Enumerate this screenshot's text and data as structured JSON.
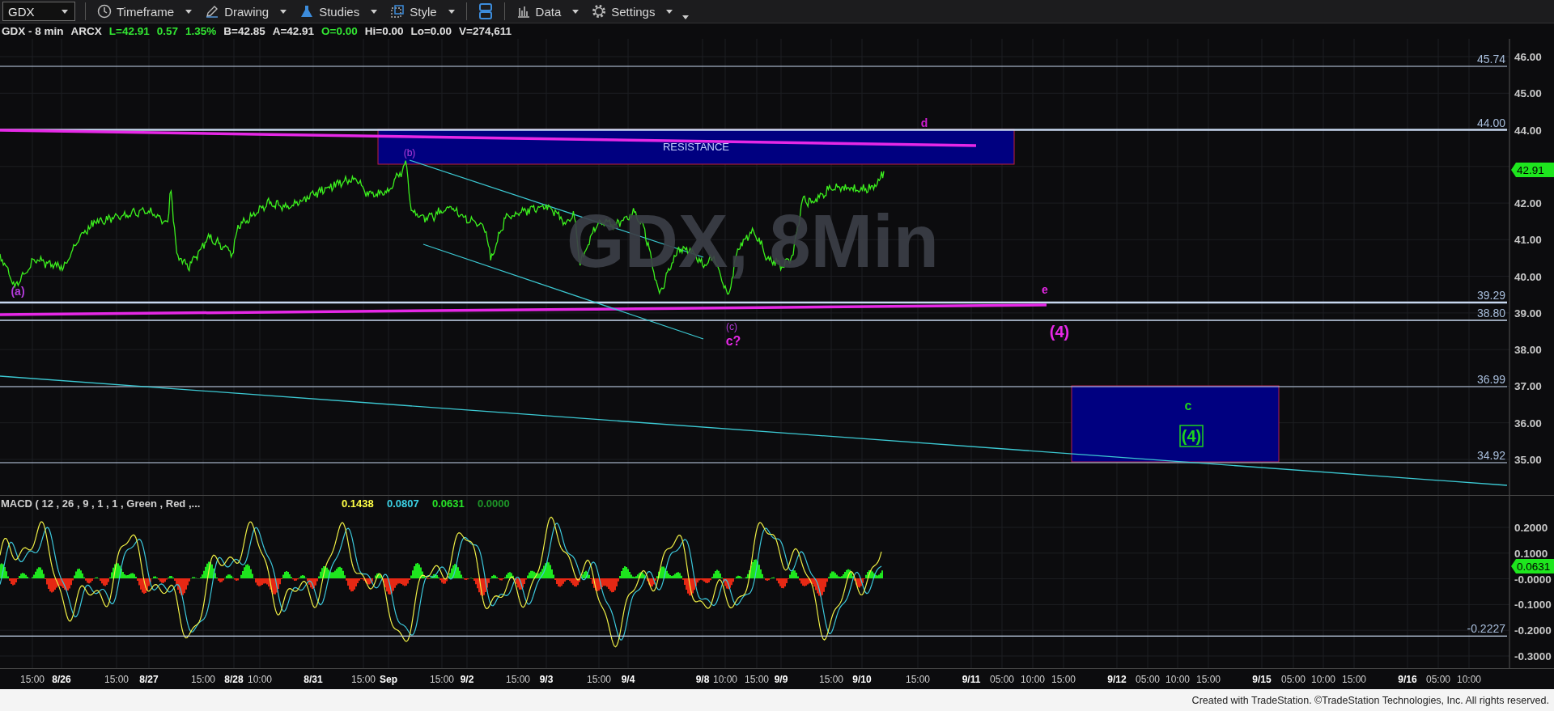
{
  "toolbar": {
    "symbol": "GDX",
    "buttons": [
      {
        "kind": "clock",
        "label": "Timeframe"
      },
      {
        "kind": "pen",
        "label": "Drawing"
      },
      {
        "kind": "flask",
        "label": "Studies"
      },
      {
        "kind": "style",
        "label": "Style"
      },
      {
        "kind": "layout"
      },
      {
        "kind": "bars",
        "label": "Data"
      },
      {
        "kind": "gear",
        "label": "Settings"
      },
      {
        "kind": "more"
      }
    ]
  },
  "quote": [
    {
      "text": "GDX - 8 min",
      "color": "#e0e0e0"
    },
    {
      "text": "ARCX",
      "color": "#e0e0e0"
    },
    {
      "text": "L=42.91",
      "color": "#33e633"
    },
    {
      "text": "0.57",
      "color": "#33e633"
    },
    {
      "text": "1.35%",
      "color": "#33e633"
    },
    {
      "text": "B=42.85",
      "color": "#e0e0e0"
    },
    {
      "text": "A=42.91",
      "color": "#e0e0e0"
    },
    {
      "text": "O=0.00",
      "color": "#33e633"
    },
    {
      "text": "Hi=0.00",
      "color": "#e0e0e0"
    },
    {
      "text": "Lo=0.00",
      "color": "#e0e0e0"
    },
    {
      "text": "V=274,611",
      "color": "#e0e0e0"
    }
  ],
  "price_chart": {
    "watermark": [
      "GDX, 8Min"
    ],
    "axis_labels": [
      "46.00",
      "45.00",
      "44.00",
      "42.00",
      "41.00",
      "40.00",
      "39.00",
      "38.00",
      "37.00",
      "36.00",
      "35.00"
    ],
    "last_price": "42.91",
    "levels": [
      {
        "label": "45.74"
      },
      {
        "label": "44.00"
      },
      {
        "label": "39.29"
      },
      {
        "label": "38.80"
      },
      {
        "label": "36.99"
      },
      {
        "label": "34.92"
      }
    ],
    "zones": [
      {
        "kind": "resistance",
        "label": "RESISTANCE"
      },
      {
        "kind": "target"
      }
    ],
    "wave_labels": [
      {
        "text": "d",
        "kind": "medium",
        "color": "#d21ed2"
      },
      {
        "text": "(b)",
        "kind": "small",
        "color": "#b43cdc"
      },
      {
        "text": "e",
        "kind": "medium",
        "color": "#e628e6"
      },
      {
        "text": "(a)",
        "kind": "medium",
        "color": "#b43cdc"
      },
      {
        "text": "(c)",
        "kind": "small",
        "color": "#b43cdc"
      },
      {
        "text": "c?",
        "kind": "bold",
        "color": "#e628e6"
      },
      {
        "text": "(4)",
        "kind": "large",
        "color": "#e628e6"
      },
      {
        "text": "c",
        "kind": "bold",
        "color": "#1ed21e"
      },
      {
        "text": "(4)",
        "kind": "boxed",
        "color": "#1ed21e"
      }
    ]
  },
  "macd": {
    "title": "MACD ( 12 , 26 , 9 , 1 , 1 , Green , Red ,...",
    "values": [
      {
        "text": "0.1438",
        "color": "#ffff46"
      },
      {
        "text": "0.0807",
        "color": "#3cd2e6"
      },
      {
        "text": "0.0631",
        "color": "#28e628"
      },
      {
        "text": "0.0000",
        "color": "#1e9628"
      }
    ],
    "axis_labels": [
      "0.2000",
      "0.1000",
      "-0.0000",
      "-0.1000",
      "-0.2000",
      "-0.3000"
    ],
    "last_value": "0.0631",
    "level_label": "-0.2227"
  },
  "time_axis": [
    {
      "text": "15:00",
      "kind": "time"
    },
    {
      "text": "8/26",
      "kind": "date"
    },
    {
      "text": "15:00",
      "kind": "time"
    },
    {
      "text": "8/27",
      "kind": "date"
    },
    {
      "text": "15:00",
      "kind": "time"
    },
    {
      "text": "8/28",
      "kind": "date"
    },
    {
      "text": "10:00",
      "kind": "time"
    },
    {
      "text": "8/31",
      "kind": "date"
    },
    {
      "text": "15:00",
      "kind": "time"
    },
    {
      "text": "Sep",
      "kind": "date"
    },
    {
      "text": "15:00",
      "kind": "time"
    },
    {
      "text": "9/2",
      "kind": "date"
    },
    {
      "text": "15:00",
      "kind": "time"
    },
    {
      "text": "9/3",
      "kind": "date"
    },
    {
      "text": "15:00",
      "kind": "time"
    },
    {
      "text": "9/4",
      "kind": "date"
    },
    {
      "text": "9/8",
      "kind": "date"
    },
    {
      "text": "10:00",
      "kind": "time"
    },
    {
      "text": "15:00",
      "kind": "time"
    },
    {
      "text": "9/9",
      "kind": "date"
    },
    {
      "text": "15:00",
      "kind": "time"
    },
    {
      "text": "9/10",
      "kind": "date"
    },
    {
      "text": "15:00",
      "kind": "time"
    },
    {
      "text": "9/11",
      "kind": "date"
    },
    {
      "text": "05:00",
      "kind": "time"
    },
    {
      "text": "10:00",
      "kind": "time"
    },
    {
      "text": "15:00",
      "kind": "time"
    },
    {
      "text": "9/12",
      "kind": "date"
    },
    {
      "text": "05:00",
      "kind": "time"
    },
    {
      "text": "10:00",
      "kind": "time"
    },
    {
      "text": "15:00",
      "kind": "time"
    },
    {
      "text": "9/15",
      "kind": "date"
    },
    {
      "text": "05:00",
      "kind": "time"
    },
    {
      "text": "10:00",
      "kind": "time"
    },
    {
      "text": "15:00",
      "kind": "time"
    },
    {
      "text": "9/16",
      "kind": "date"
    },
    {
      "text": "05:00",
      "kind": "time"
    },
    {
      "text": "10:00",
      "kind": "time"
    }
  ],
  "footer": "Created with TradeStation. ©TradeStation Technologies, Inc. All rights reserved."
}
